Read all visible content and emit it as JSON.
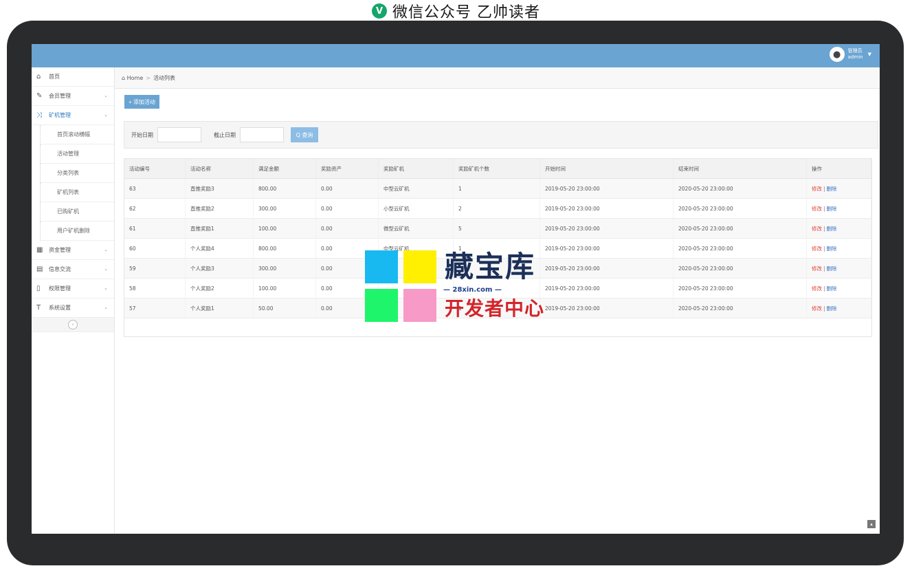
{
  "caption": {
    "text": "微信公众号  乙帅读者",
    "icon": "wechat-v-logo",
    "icon_char": "V"
  },
  "header": {
    "user_role": "管理员",
    "user_name": "admin",
    "avatar_icon": "user-avatar-icon"
  },
  "sidebar": {
    "items": [
      {
        "label": "首页",
        "icon": "home-icon",
        "glyph": "⌂"
      },
      {
        "label": "会员管理",
        "icon": "edit-icon",
        "glyph": "✎"
      },
      {
        "label": "矿机管理",
        "icon": "shuffle-icon",
        "glyph": "⤨"
      },
      {
        "label": "资金管理",
        "icon": "calendar-icon",
        "glyph": "▦"
      },
      {
        "label": "信息交流",
        "icon": "message-icon",
        "glyph": "▤"
      },
      {
        "label": "权限管理",
        "icon": "file-icon",
        "glyph": "▯"
      },
      {
        "label": "系统设置",
        "icon": "text-icon",
        "glyph": "T"
      }
    ],
    "subitems": [
      "首页滚动横幅",
      "活动管理",
      "分类列表",
      "矿机列表",
      "已购矿机",
      "用户矿机删除"
    ],
    "chevron": "⌄",
    "collapse": "‹"
  },
  "breadcrumb": {
    "home": "Home",
    "sep": ">",
    "current": "活动列表"
  },
  "toolbar": {
    "add_label": "+ 添加活动"
  },
  "filter": {
    "start_label": "开始日期",
    "end_label": "截止日期",
    "search_label": "Q 查询"
  },
  "table": {
    "headers": [
      "活动编号",
      "活动名称",
      "满足金额",
      "奖励资产",
      "奖励矿机",
      "奖励矿机个数",
      "开始时间",
      "结束时间",
      "操作"
    ],
    "rows": [
      [
        "63",
        "直推奖励3",
        "800.00",
        "0.00",
        "中型云矿机",
        "1",
        "2019-05-20 23:00:00",
        "2020-05-20 23:00:00"
      ],
      [
        "62",
        "直推奖励2",
        "300.00",
        "0.00",
        "小型云矿机",
        "2",
        "2019-05-20 23:00:00",
        "2020-05-20 23:00:00"
      ],
      [
        "61",
        "直推奖励1",
        "100.00",
        "0.00",
        "微型云矿机",
        "5",
        "2019-05-20 23:00:00",
        "2020-05-20 23:00:00"
      ],
      [
        "60",
        "个人奖励4",
        "800.00",
        "0.00",
        "中型云矿机",
        "1",
        "2019-05-20 23:00:00",
        "2020-05-20 23:00:00"
      ],
      [
        "59",
        "个人奖励3",
        "300.00",
        "0.00",
        "",
        "",
        "2019-05-20 23:00:00",
        "2020-05-20 23:00:00"
      ],
      [
        "58",
        "个人奖励2",
        "100.00",
        "0.00",
        "",
        "",
        "2019-05-20 23:00:00",
        "2020-05-20 23:00:00"
      ],
      [
        "57",
        "个人奖励1",
        "50.00",
        "0.00",
        "",
        "1",
        "2019-05-20 23:00:00",
        "2020-05-20 23:00:00"
      ]
    ],
    "op_edit": "修改",
    "op_sep": "|",
    "op_delete": "删除"
  },
  "watermark": {
    "title": "藏宝库",
    "site": "— 28xin.com —",
    "subtitle": "开发者中心",
    "colors": [
      "#18b9f0",
      "#fef000",
      "#1ef56a",
      "#f79ac8"
    ]
  },
  "back_to_top": "▴",
  "device": {
    "apple_logo": ""
  }
}
